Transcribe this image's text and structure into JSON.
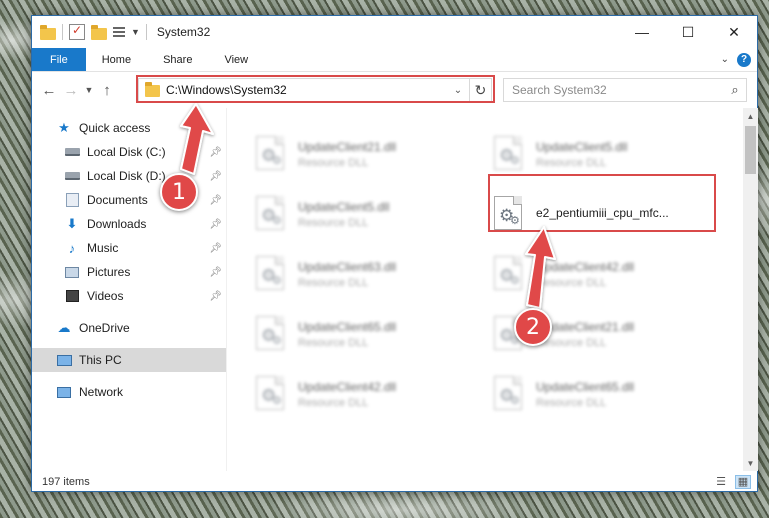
{
  "window": {
    "title": "System32",
    "controls": {
      "minimize": "—",
      "maximize": "☐",
      "close": "✕"
    }
  },
  "ribbon": {
    "tabs": [
      "File",
      "Home",
      "Share",
      "View"
    ],
    "help": "?"
  },
  "address": {
    "path": "C:\\Windows\\System32",
    "search_placeholder": "Search System32"
  },
  "sidebar": {
    "quick_access": "Quick access",
    "quick_items": [
      "Local Disk (C:)",
      "Local Disk (D:)",
      "Documents",
      "Downloads",
      "Music",
      "Pictures",
      "Videos"
    ],
    "onedrive": "OneDrive",
    "this_pc": "This PC",
    "network": "Network"
  },
  "files": {
    "left": [
      {
        "name": "UpdateClient21.dll",
        "type": "Resource DLL"
      },
      {
        "name": "UpdateClient5.dll",
        "type": "Resource DLL"
      },
      {
        "name": "UpdateClient63.dll",
        "type": "Resource DLL"
      },
      {
        "name": "UpdateClient65.dll",
        "type": "Resource DLL"
      },
      {
        "name": "UpdateClient42.dll",
        "type": "Resource DLL"
      }
    ],
    "right": [
      {
        "name": "UpdateClient5.dll",
        "type": "Resource DLL"
      },
      {
        "name": "e2_pentiumiii_cpu_mfc...",
        "type": ""
      },
      {
        "name": "UpdateClient42.dll",
        "type": "Resource DLL"
      },
      {
        "name": "UpdateClient21.dll",
        "type": "Resource DLL"
      },
      {
        "name": "UpdateClient65.dll",
        "type": "Resource DLL"
      }
    ]
  },
  "status": {
    "item_count": "197 items"
  },
  "annotations": {
    "step1": "1",
    "step2": "2",
    "color": "#e04848"
  }
}
